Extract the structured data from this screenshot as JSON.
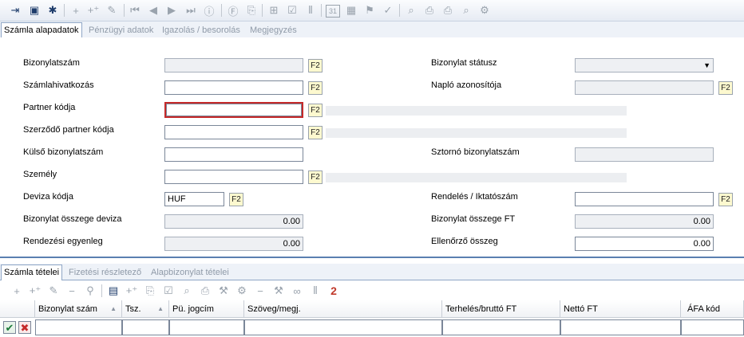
{
  "toolbar": {
    "icons": [
      "exit-icon",
      "save-icon",
      "save-new-icon",
      "add-icon",
      "add-multi-icon",
      "edit-icon",
      "first-icon",
      "prev-icon",
      "next-icon",
      "last-icon",
      "info-icon",
      "filter-icon",
      "copy-icon",
      "post-icon",
      "approve-icon",
      "split-icon",
      "calendar-icon",
      "calendar-add-icon",
      "flag-icon",
      "stamp-icon",
      "preview-icon",
      "export-icon",
      "print-icon",
      "print-preview-icon",
      "print-settings-icon"
    ],
    "calendar_label": "31"
  },
  "top_tabs": [
    "Számla alapadatok",
    "Pénzügyi adatok",
    "Igazolás / besorolás",
    "Megjegyzés"
  ],
  "form": {
    "f2_label": "F2",
    "left": {
      "bizonylatszam": {
        "label": "Bizonylatszám",
        "value": ""
      },
      "szamlahivatkozas": {
        "label": "Számlahivatkozás",
        "value": ""
      },
      "partner_kodja": {
        "label": "Partner kódja",
        "value": ""
      },
      "szerzodo_partner": {
        "label": "Szerződő partner kódja",
        "value": ""
      },
      "kulso_bizonylatszam": {
        "label": "Külső bizonylatszám",
        "value": ""
      },
      "szemely": {
        "label": "Személy",
        "value": ""
      },
      "deviza_kodja": {
        "label": "Deviza kódja",
        "value": "HUF"
      },
      "osszeg_deviza": {
        "label": "Bizonylat összege deviza",
        "value": "0.00"
      },
      "rendezesi_egyenleg": {
        "label": "Rendezési egyenleg",
        "value": "0.00"
      }
    },
    "right": {
      "bizonylat_statusz": {
        "label": "Bizonylat státusz",
        "value": ""
      },
      "naplo_azonosito": {
        "label": "Napló azonosítója",
        "value": ""
      },
      "sztorno_bizonylatszam": {
        "label": "Sztornó bizonylatszám",
        "value": ""
      },
      "rendeles_iktatoszam": {
        "label": "Rendelés / Iktatószám",
        "value": ""
      },
      "osszeg_ft": {
        "label": "Bizonylat összege FT",
        "value": "0.00"
      },
      "ellenorzo_osszeg": {
        "label": "Ellenőrző összeg",
        "value": "0.00"
      }
    }
  },
  "bottom_tabs": [
    "Számla tételei",
    "Fizetési részletező",
    "Alapbizonylat tételei"
  ],
  "grid_toolbar": {
    "icons": [
      "add-icon",
      "add-multi-icon",
      "edit-icon",
      "remove-icon",
      "search-icon",
      "grid-icon",
      "add-row-icon",
      "copy-icon",
      "edit-row-icon",
      "preview-icon",
      "export-icon",
      "tool-icon",
      "settings-icon",
      "remove2-icon",
      "hammer-icon",
      "binoculars-icon",
      "split-icon"
    ],
    "count": "2"
  },
  "grid": {
    "columns": [
      "Bizonylat szám",
      "Tsz.",
      "Pü. jogcím",
      "Szöveg/megj.",
      "Terhelés/bruttó FT",
      "Nettó FT",
      "ÁFA kód"
    ]
  },
  "colors": {
    "accent": "#5a7fb0",
    "focus": "#c52a2a",
    "f2_bg": "#fdf9cf"
  }
}
